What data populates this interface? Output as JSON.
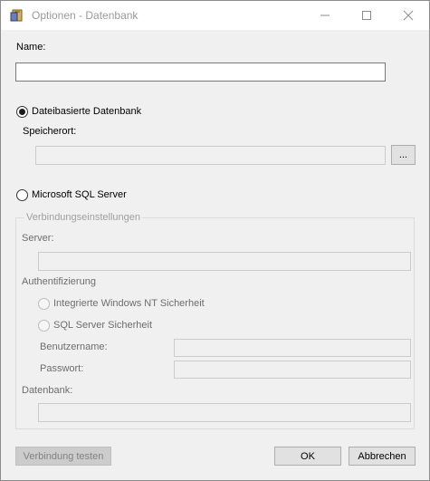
{
  "window": {
    "title": "Optionen - Datenbank",
    "controls": {
      "minimize_icon": "minimize-icon",
      "maximize_icon": "maximize-icon",
      "close_icon": "close-icon"
    }
  },
  "form": {
    "name_label": "Name:",
    "name_value": "",
    "file_db_label": "Dateibasierte Datenbank",
    "file_db_selected": true,
    "storage_label": "Speicherort:",
    "storage_value": "",
    "browse_label": "...",
    "sql_label": "Microsoft SQL Server",
    "sql_selected": false,
    "connection_group": "Verbindungseinstellungen",
    "server_label": "Server:",
    "auth_label": "Authentifizierung",
    "auth_windows_label": "Integrierte Windows NT Sicherheit",
    "auth_sql_label": "SQL Server Sicherheit",
    "username_label": "Benutzername:",
    "password_label": "Passwort:",
    "database_label": "Datenbank:"
  },
  "buttons": {
    "test_label": "Verbindung testen",
    "ok_label": "OK",
    "cancel_label": "Abbrechen"
  }
}
